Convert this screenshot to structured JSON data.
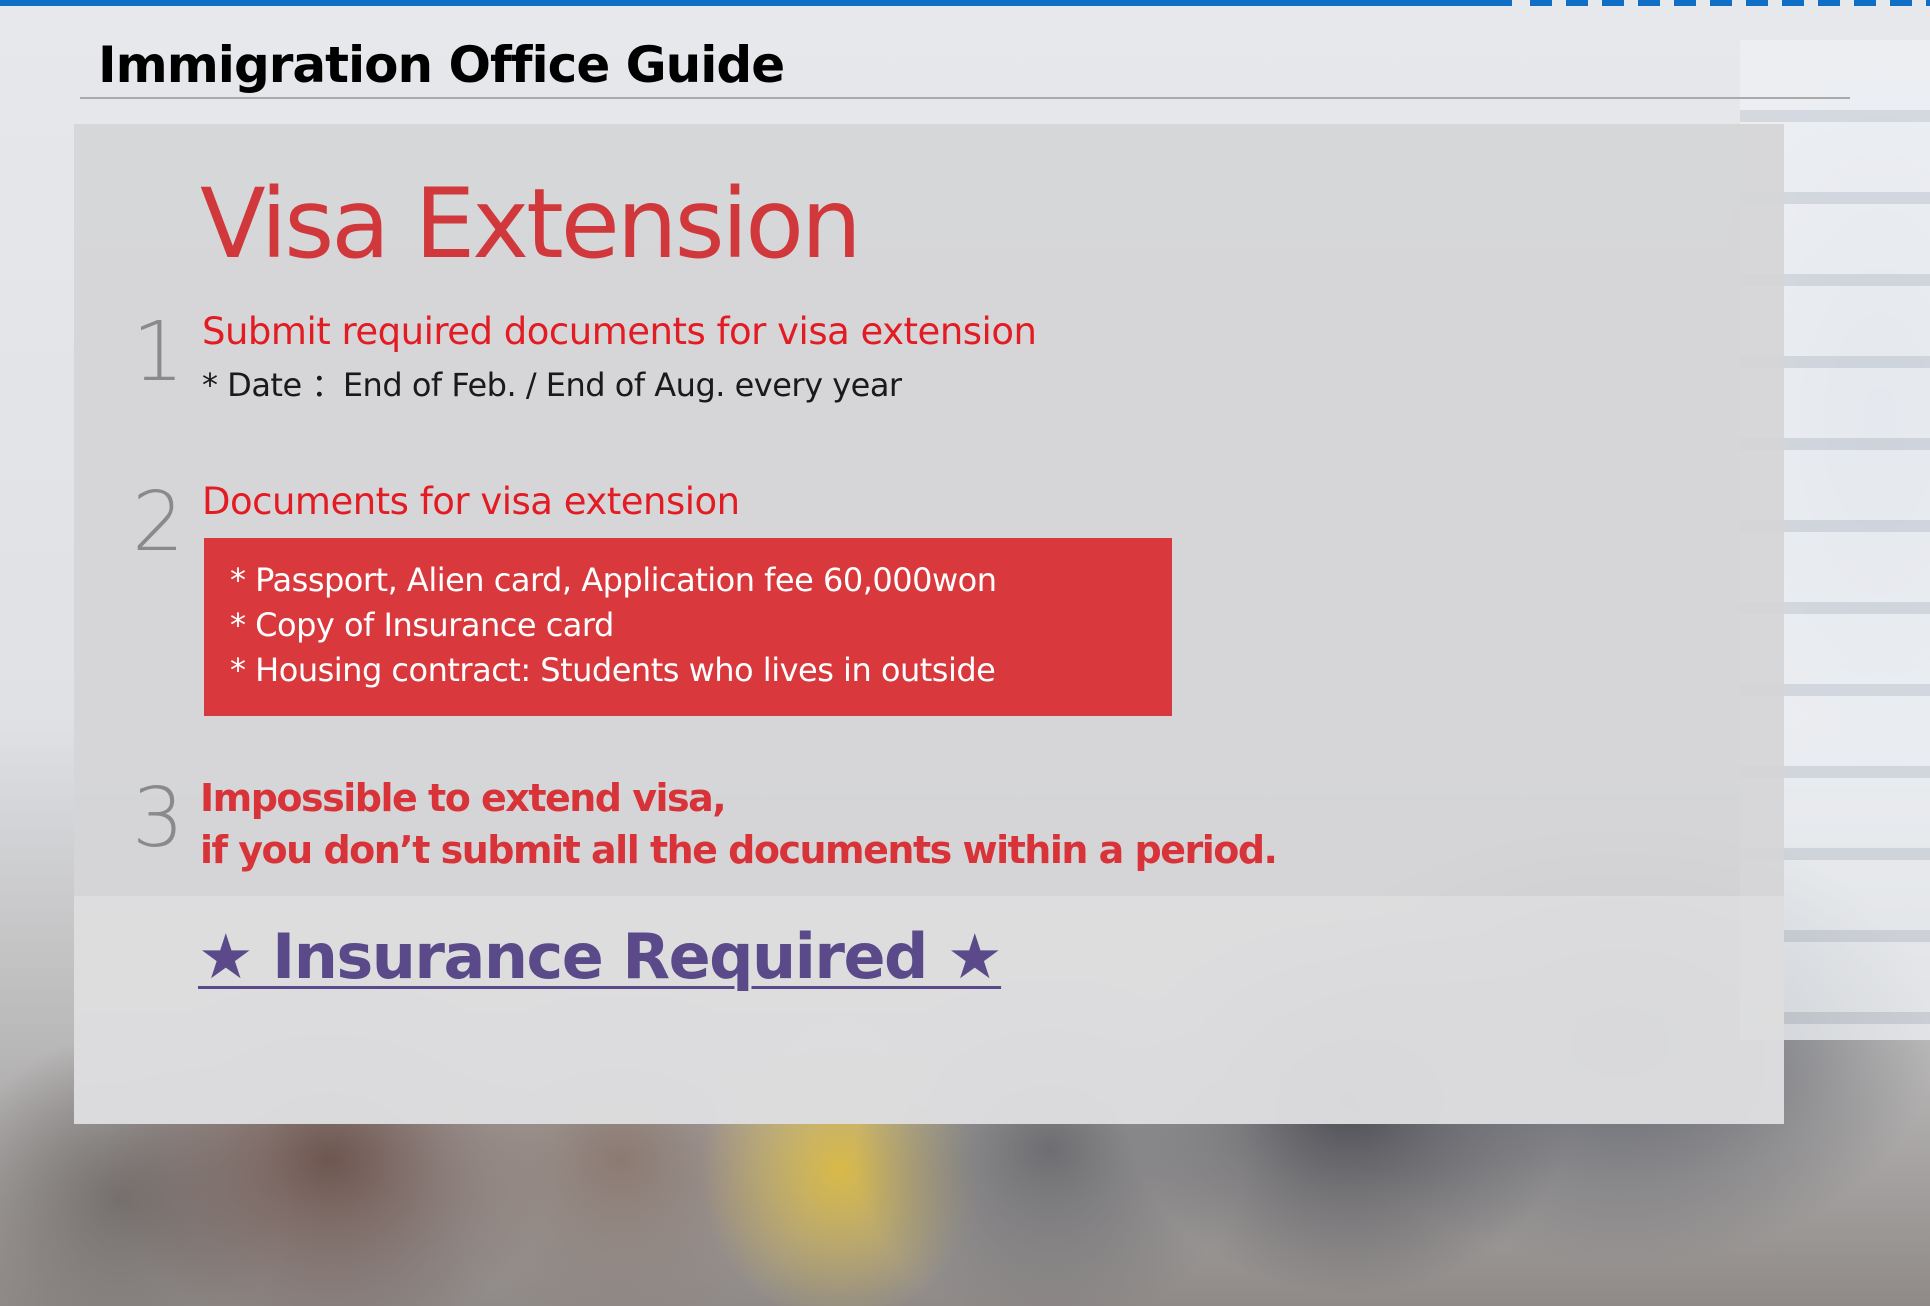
{
  "header": {
    "title": "Immigration Office Guide"
  },
  "panel": {
    "title": "Visa Extension",
    "steps": [
      {
        "number": "1",
        "title": "Submit required documents for visa extension",
        "note": "* Date ：End of Feb. / End of Aug. every year"
      },
      {
        "number": "2",
        "title": "Documents for visa extension",
        "documents": [
          "* Passport, Alien card, Application fee 60,000won",
          "* Copy of Insurance card",
          "* Housing contract: Students who lives in outside"
        ]
      },
      {
        "number": "3",
        "lines": [
          "Impossible to extend visa,",
          "if you don’t submit all the documents within a period."
        ]
      }
    ],
    "insurance_link": "★ Insurance Required ★"
  },
  "colors": {
    "accent_bar": "#0f6fc6",
    "title_red": "#d0383c",
    "step_red": "#e31b23",
    "box_red": "#d9393d",
    "link_purple": "#5a4a8a"
  }
}
